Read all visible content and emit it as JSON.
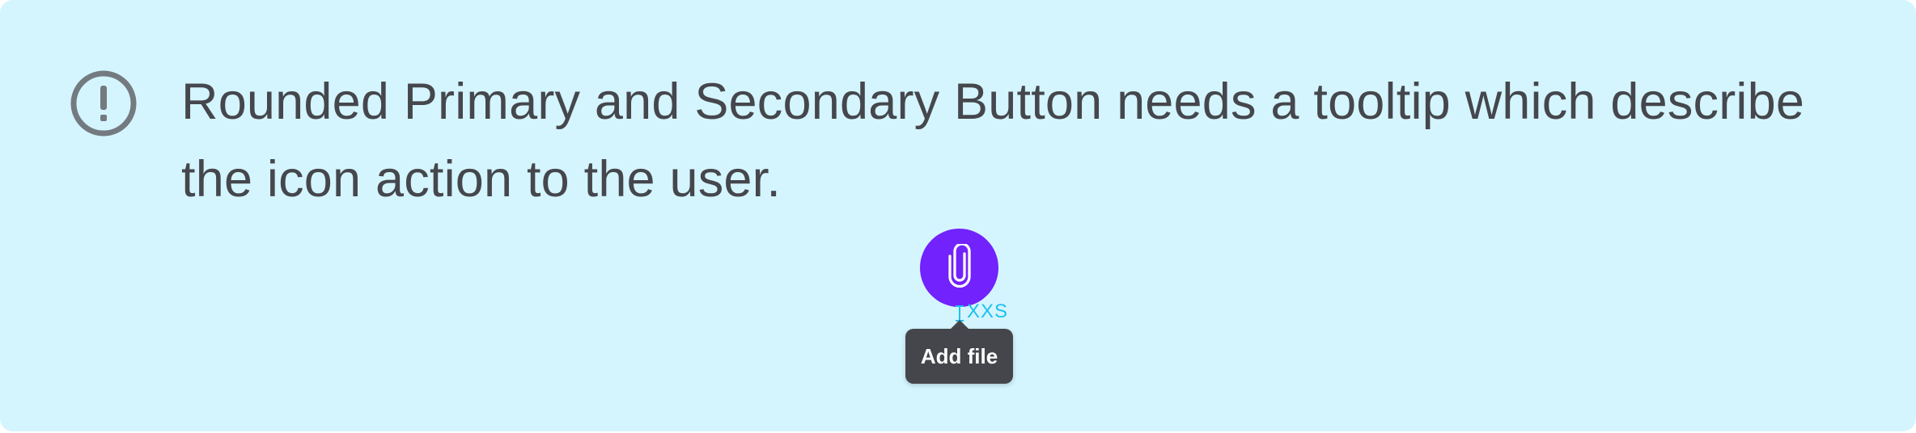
{
  "callout": {
    "background_color": "#d4f5fe",
    "icon": "info-exclamation-icon",
    "message": "Rounded Primary and Secondary Button needs a tooltip which describe the icon action to the user."
  },
  "example": {
    "button": {
      "icon": "paperclip-icon",
      "color": "#7222fc"
    },
    "spacing_label": "XXS",
    "spacing_color": "#1ec0f0",
    "tooltip": {
      "text": "Add file",
      "color": "#45464b"
    }
  }
}
